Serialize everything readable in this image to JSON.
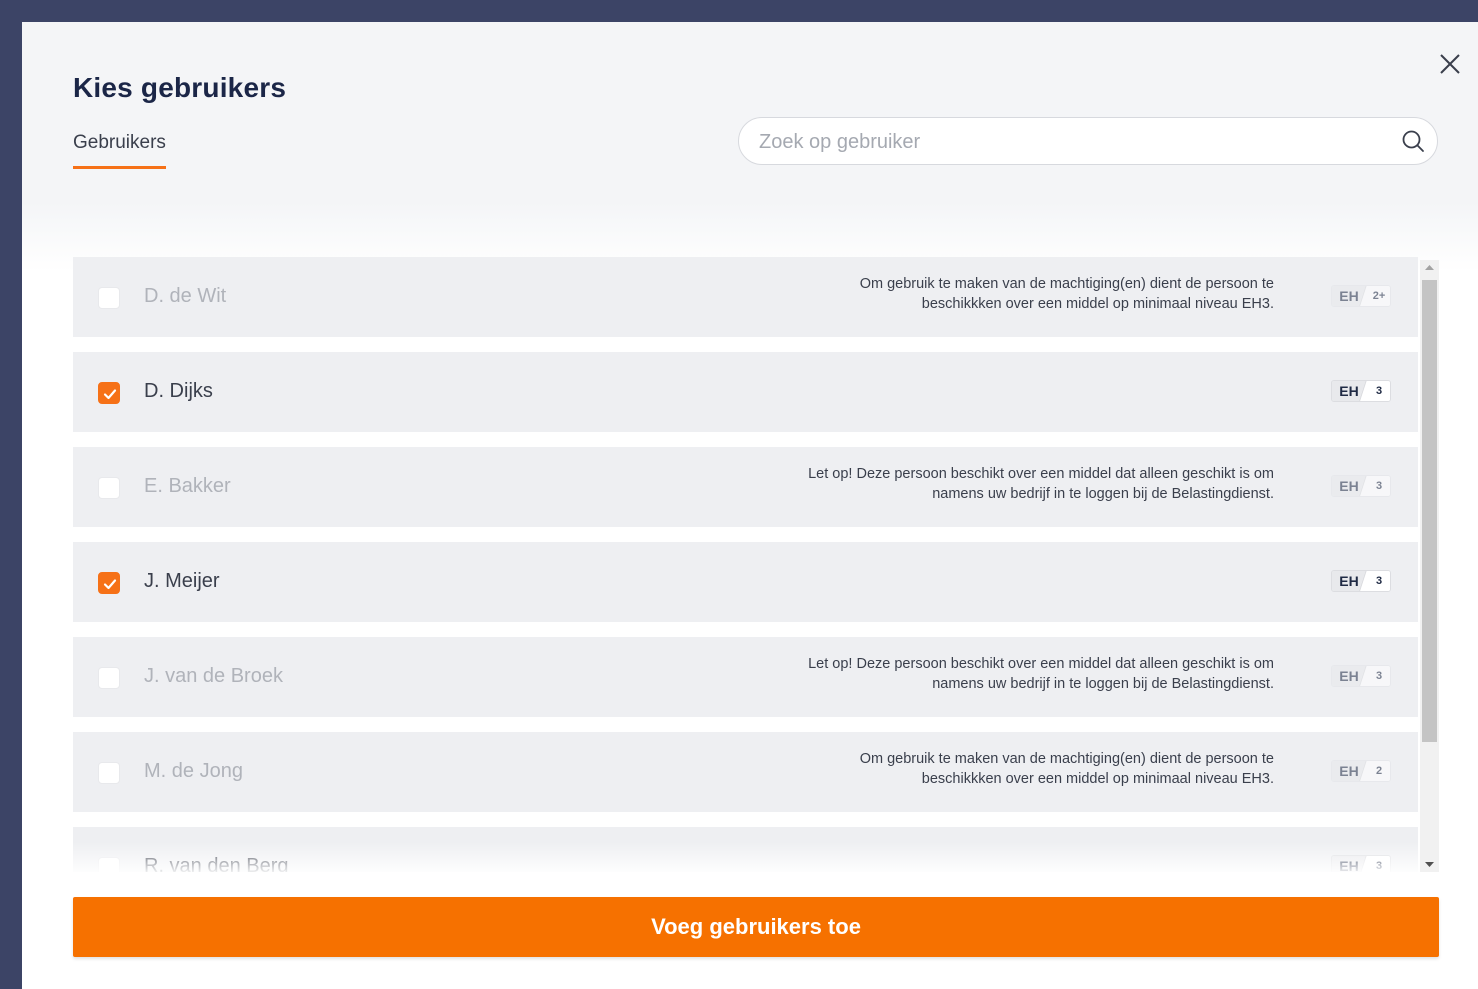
{
  "modal": {
    "title": "Kies gebruikers",
    "tab_label": "Gebruikers",
    "close_icon": "close-icon"
  },
  "search": {
    "placeholder": "Zoek op gebruiker",
    "value": "",
    "icon": "search-icon"
  },
  "users": [
    {
      "name": "D. de Wit",
      "checked": false,
      "enabled": false,
      "note_line1": "Om gebruik te maken van de machtiging(en) dient de persoon te",
      "note_line2": "beschikkken over een middel op minimaal niveau EH3.",
      "badge_label": "EH",
      "badge_level": "2+"
    },
    {
      "name": "D. Dijks",
      "checked": true,
      "enabled": true,
      "note_line1": "",
      "note_line2": "",
      "badge_label": "EH",
      "badge_level": "3"
    },
    {
      "name": "E. Bakker",
      "checked": false,
      "enabled": false,
      "note_line1": "Let op! Deze persoon beschikt over een middel dat alleen geschikt is om",
      "note_line2": "namens uw bedrijf in te loggen bij de Belastingdienst.",
      "badge_label": "EH",
      "badge_level": "3"
    },
    {
      "name": "J. Meijer",
      "checked": true,
      "enabled": true,
      "note_line1": "",
      "note_line2": "",
      "badge_label": "EH",
      "badge_level": "3"
    },
    {
      "name": "J. van de Broek",
      "checked": false,
      "enabled": false,
      "note_line1": "Let op! Deze persoon beschikt over een middel dat alleen geschikt is om",
      "note_line2": "namens uw bedrijf in te loggen bij de Belastingdienst.",
      "badge_label": "EH",
      "badge_level": "3"
    },
    {
      "name": "M. de Jong",
      "checked": false,
      "enabled": false,
      "note_line1": "Om gebruik te maken van de machtiging(en) dient de persoon te",
      "note_line2": "beschikkken over een middel op minimaal niveau EH3.",
      "badge_label": "EH",
      "badge_level": "2"
    },
    {
      "name": "R. van den Berg",
      "checked": false,
      "enabled": true,
      "note_line1": "",
      "note_line2": "",
      "badge_label": "EH",
      "badge_level": "3"
    }
  ],
  "footer": {
    "add_button_label": "Voeg gebruikers toe"
  },
  "colors": {
    "accent": "#f67100",
    "title": "#1b2647",
    "row_bg": "#eeeff2",
    "overlay": "#3c4466"
  }
}
